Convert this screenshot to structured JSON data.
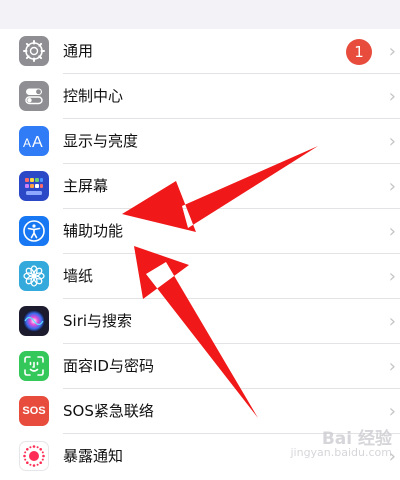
{
  "settings": {
    "items": [
      {
        "label": "通用",
        "icon": "gear-icon",
        "color": "#8e8e93",
        "badge": "1"
      },
      {
        "label": "控制中心",
        "icon": "toggles-icon",
        "color": "#8e8e93"
      },
      {
        "label": "显示与亮度",
        "icon": "text-size-icon",
        "color": "#2f7cf6"
      },
      {
        "label": "主屏幕",
        "icon": "home-screen-grid-icon",
        "color": "#2b48c7"
      },
      {
        "label": "辅助功能",
        "icon": "accessibility-icon",
        "color": "#1877f2"
      },
      {
        "label": "墙纸",
        "icon": "flower-icon",
        "color": "#34aadc"
      },
      {
        "label": "Siri与搜索",
        "icon": "siri-icon",
        "color": "#1c1c2e"
      },
      {
        "label": "面容ID与密码",
        "icon": "face-id-icon",
        "color": "#34c759"
      },
      {
        "label": "SOS紧急联络",
        "icon": "sos-icon",
        "color": "#e74c3c",
        "icon_text": "SOS"
      },
      {
        "label": "暴露通知",
        "icon": "exposure-notification-icon",
        "color": "#ffffff"
      }
    ]
  },
  "annotation": {
    "arrow_color": "#f01818"
  },
  "watermark": {
    "line1": "Bai 经验",
    "line2": "jingyan.baidu.com"
  }
}
